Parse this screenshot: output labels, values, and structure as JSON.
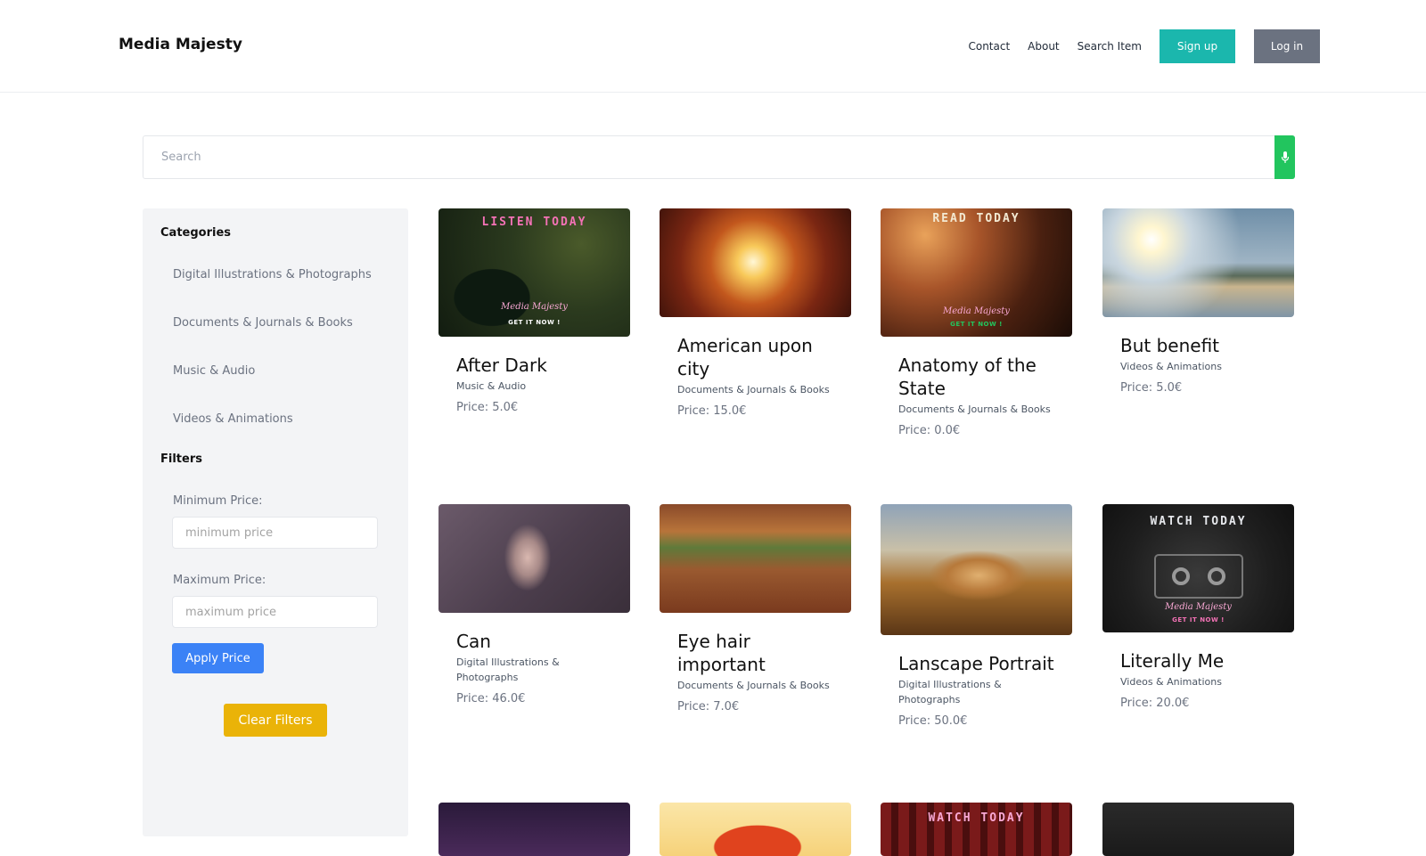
{
  "header": {
    "brand": "Media Majesty",
    "nav": {
      "contact": "Contact",
      "about": "About",
      "search_item": "Search Item"
    },
    "signup_label": "Sign up",
    "login_label": "Log in"
  },
  "search": {
    "placeholder": "Search"
  },
  "sidebar": {
    "categories_heading": "Categories",
    "categories": [
      "Digital Illustrations & Photographs",
      "Documents & Journals & Books",
      "Music & Audio",
      "Videos & Animations"
    ],
    "filters_heading": "Filters",
    "min_price_label": "Minimum Price:",
    "min_price_placeholder": "minimum price",
    "max_price_label": "Maximum Price:",
    "max_price_placeholder": "maximum price",
    "apply_label": "Apply Price",
    "clear_label": "Clear Filters"
  },
  "colors": {
    "accent_teal": "#1bb7ad",
    "login_gray": "#6b7280",
    "mic_green": "#22c55e",
    "apply_blue": "#3b82f6",
    "clear_yellow": "#eab308"
  },
  "cards": [
    {
      "title": "After Dark",
      "category": "Music & Audio",
      "price": "Price: 5.0€",
      "image": "vinyl-turntable",
      "overlay": "LISTEN TODAY",
      "signature": "Media Majesty",
      "cta": "GET IT NOW !"
    },
    {
      "title": "American upon city",
      "category": "Documents & Journals & Books",
      "price": "Price: 15.0€",
      "image": "building-courtyard-sky"
    },
    {
      "title": "Anatomy of the State",
      "category": "Documents & Journals & Books",
      "price": "Price: 0.0€",
      "image": "typewriter-lamp",
      "overlay": "READ TODAY",
      "signature": "Media Majesty",
      "cta": "GET IT NOW !"
    },
    {
      "title": "But benefit",
      "category": "Videos & Animations",
      "price": "Price: 5.0€",
      "image": "sunny-beach"
    },
    {
      "title": "Can",
      "category": "Digital Illustrations & Photographs",
      "price": "Price: 46.0€",
      "image": "hand-on-wet-glass"
    },
    {
      "title": "Eye hair important",
      "category": "Documents & Journals & Books",
      "price": "Price: 7.0€",
      "image": "autumn-path"
    },
    {
      "title": "Lanscape Portrait",
      "category": "Digital Illustrations & Photographs",
      "price": "Price: 50.0€",
      "image": "desert-rock-painting"
    },
    {
      "title": "Literally Me",
      "category": "Videos & Animations",
      "price": "Price: 20.0€",
      "image": "cassette-tape",
      "overlay": "WATCH TODAY",
      "signature": "Media Majesty",
      "cta": "GET IT NOW !"
    },
    {
      "image": "purple-dusk"
    },
    {
      "image": "sunset-silhouette"
    },
    {
      "image": "plaid-watch",
      "overlay": "WATCH TODAY"
    },
    {
      "image": "dark-texture"
    }
  ]
}
